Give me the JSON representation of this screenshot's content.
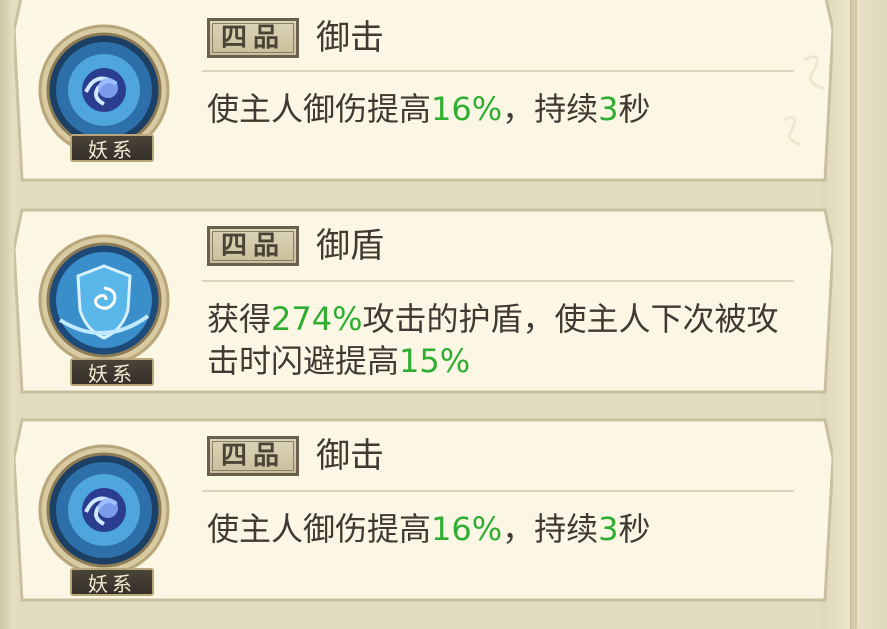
{
  "colors": {
    "highlight": "#2fae31",
    "text": "#3f3a32",
    "card_bg": "#fbf7e4",
    "card_border": "#c9c0a0"
  },
  "skills": [
    {
      "grade": "四品",
      "name": "御击",
      "school": "妖系",
      "icon": "blue-spirit-orb-icon",
      "description": {
        "p1": "使主人御伤提高",
        "v1": "16%",
        "p2": "，持续",
        "v2": "3",
        "p3": "秒"
      }
    },
    {
      "grade": "四品",
      "name": "御盾",
      "school": "妖系",
      "icon": "swirl-shield-icon",
      "description": {
        "p1": "获得",
        "v1": "274%",
        "p2": "攻击的护盾，使主人下次被攻击时闪避提高",
        "v2": "15%"
      }
    },
    {
      "grade": "四品",
      "name": "御击",
      "school": "妖系",
      "icon": "blue-spirit-orb-icon",
      "description": {
        "p1": "使主人御伤提高",
        "v1": "16%",
        "p2": "，持续",
        "v2": "3",
        "p3": "秒"
      }
    }
  ]
}
